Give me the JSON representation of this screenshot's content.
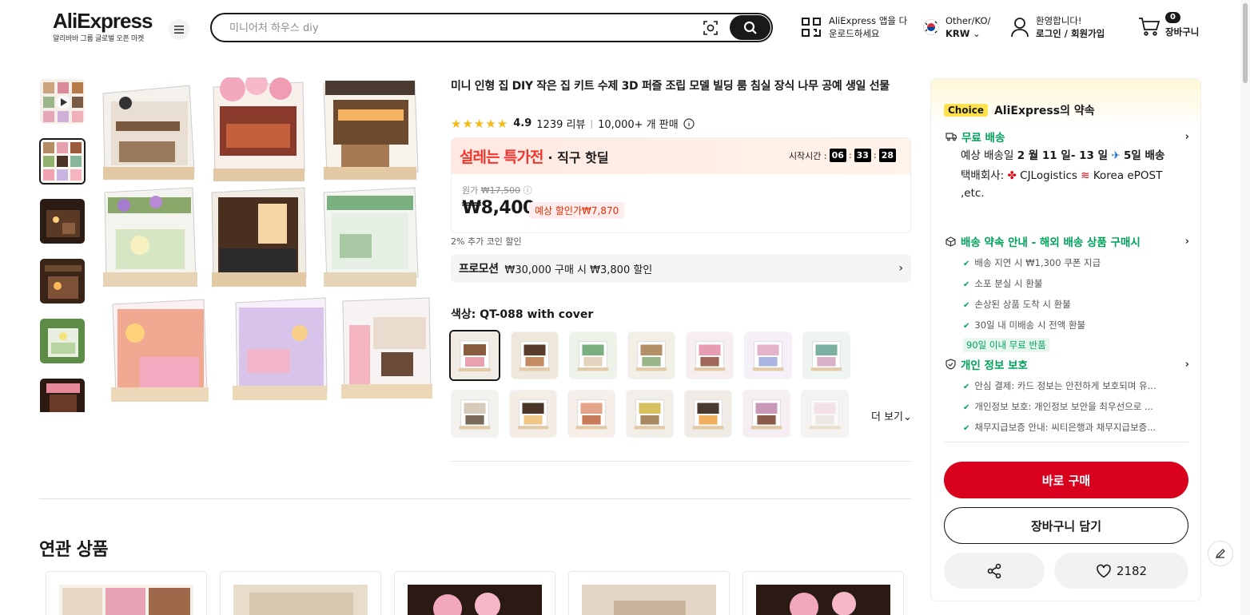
{
  "header": {
    "logo_main": "AliExpress",
    "logo_sub": "알리바바 그룹 글로벌 오픈 마켓",
    "search_placeholder": "미니어처 하우스 diy",
    "app_download_line1": "AliExpress 앱을 다",
    "app_download_line2": "운로드하세요",
    "region_line1": "Other/KO/",
    "region_line2": "KRW",
    "greeting": "환영합니다!",
    "login": "로그인 / 회원가입",
    "cart_label": "장바구니",
    "cart_count": "0",
    "icons": [
      "menu-icon",
      "camera-search-icon",
      "search-icon",
      "qr-code-icon",
      "korea-flag-icon",
      "user-icon",
      "cart-icon"
    ]
  },
  "product": {
    "title": "미니 인형 집 DIY 작은 집 키트 수제 3D 퍼즐 조립 모델 빌딩 룸 침실 장식 나무 공예 생일 선물",
    "rating": "4.9",
    "reviews": "1239 리뷰",
    "sold": "10,000+ 개 판매",
    "stars": "★★★★★",
    "deal_name": "설레는 특가전",
    "deal_sub": "· 직구 핫딜",
    "timer_label": "시작시간 :",
    "timer_h": "06",
    "timer_m": "33",
    "timer_s": "28",
    "orig_label": "원가",
    "orig_price": "₩17,500",
    "price": "₩8,400",
    "est_price": "예상 할인가₩7,870",
    "coin_text": "2% 추가 코인 할인",
    "promo_tag": "프로모션",
    "promo_text": "₩30,000 구매 시 ₩3,800 할인",
    "color_label": "색상: QT-088 with cover",
    "more_label": "더 보기",
    "swatch_count": 14
  },
  "related": {
    "title": "연관 상품"
  },
  "panel": {
    "choice_tag": "Choice",
    "choice_title": "AliExpress의 약속",
    "shipping_title": "무료 배송",
    "ship_line_a": "예상 배송일",
    "ship_dates": "2 월 11 일- 13 일",
    "ship_days": "5일 배송",
    "carrier_label": "택배회사:",
    "carrier_name": "CJLogistics",
    "carrier_rest": "Korea ePOST ,etc.",
    "delivery_title": "배송 약속 안내 - 해외 배송 상품 구매시",
    "delivery_items": [
      "배송 지연 시 ₩1,300 쿠폰 지급",
      "소포 분실 시 환불",
      "손상된 상품 도착 시 환불",
      "30일 내 미배송 시 전액 환불"
    ],
    "free_return": "90일 이내 무료 반품",
    "privacy_title": "개인 정보 보호",
    "privacy_items": [
      "안심 결제: 카드 정보는 안전하게 보호되며 유...",
      "개인정보 보호: 개인정보 보안을 최우선으로 ...",
      "채무지급보증 안내: 씨티은행과 채무지급보증..."
    ],
    "buy_now": "바로 구매",
    "add_cart": "장바구니 담기",
    "wishlist_count": "2182"
  },
  "colors": {
    "brand_red": "#d8001c",
    "deal_red": "#f2362d",
    "choice_green": "#00a25a",
    "choice_yellow": "#ffe14d",
    "star_yellow": "#f5b916"
  }
}
